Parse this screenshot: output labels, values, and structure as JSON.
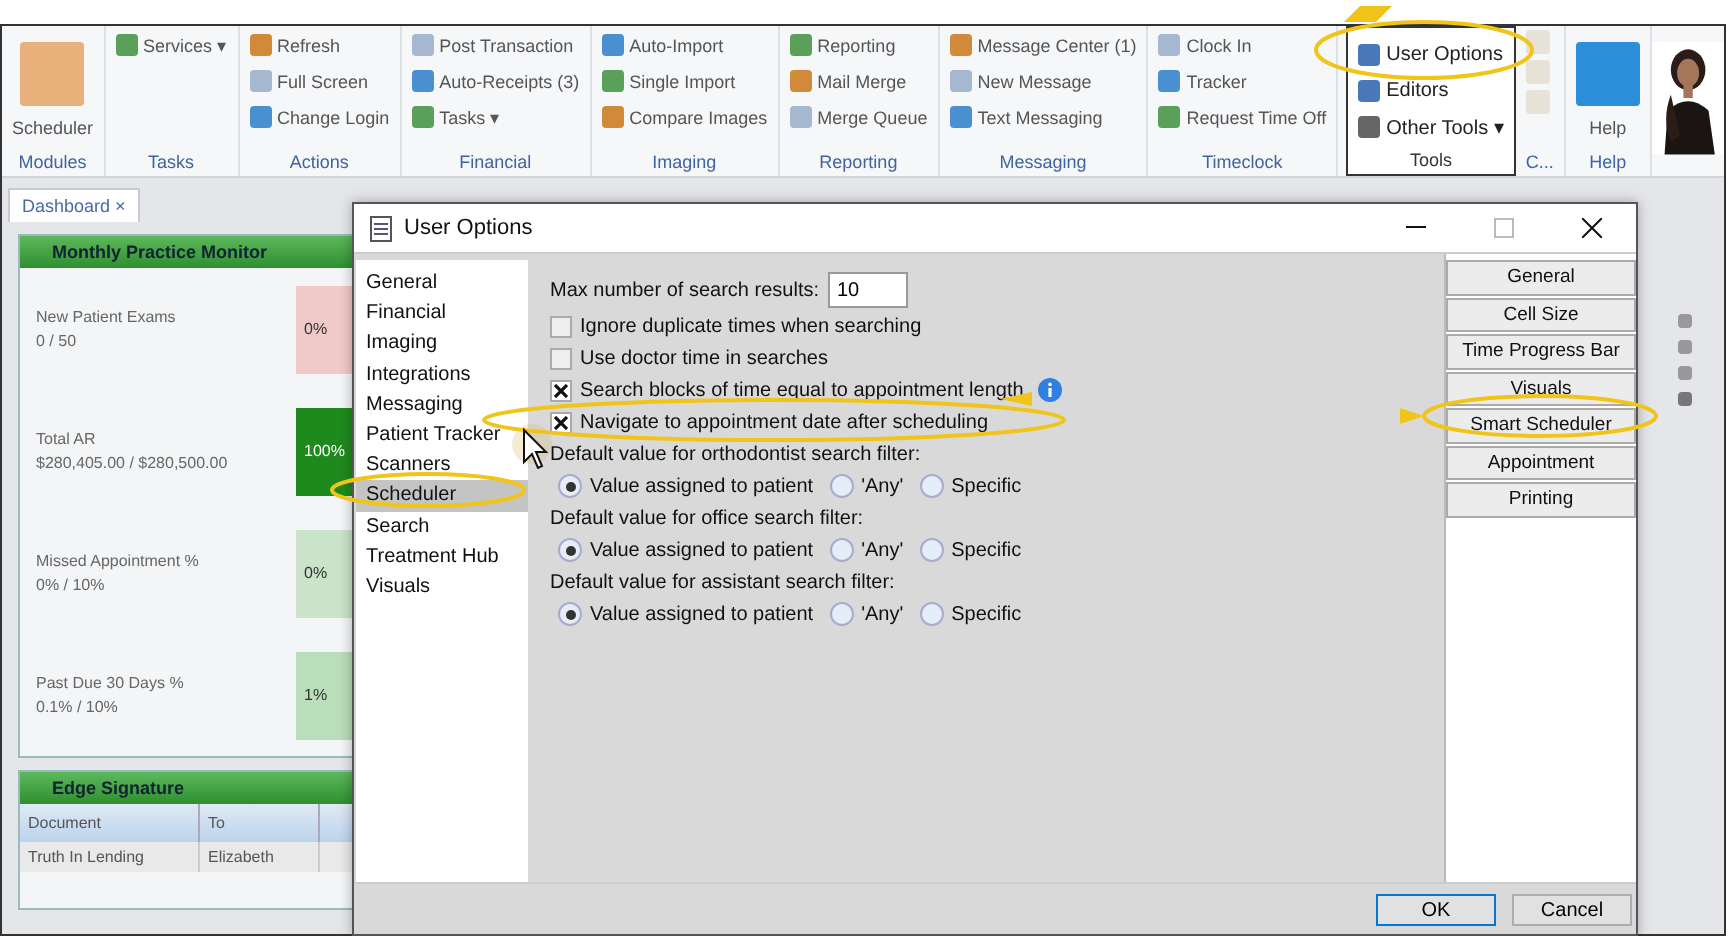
{
  "ribbon": {
    "groups": [
      {
        "label": "Modules",
        "highlighted": false,
        "large": true,
        "items": [
          "Scheduler"
        ]
      },
      {
        "label": "Tasks",
        "highlighted": false,
        "large": false,
        "items": [
          "Services ▾"
        ]
      },
      {
        "label": "Actions",
        "highlighted": false,
        "large": false,
        "items": [
          "Refresh",
          "Full Screen",
          "Change Login"
        ]
      },
      {
        "label": "Financial",
        "highlighted": false,
        "large": false,
        "items": [
          "Post Transaction",
          "Auto-Receipts (3)",
          "Tasks ▾"
        ]
      },
      {
        "label": "Imaging",
        "highlighted": false,
        "large": false,
        "items": [
          "Auto-Import",
          "Single Import",
          "Compare Images"
        ]
      },
      {
        "label": "Reporting",
        "highlighted": false,
        "large": false,
        "items": [
          "Reporting",
          "Mail Merge",
          "Merge Queue"
        ]
      },
      {
        "label": "Messaging",
        "highlighted": false,
        "large": false,
        "items": [
          "Message Center (1)",
          "New Message",
          "Text Messaging"
        ]
      },
      {
        "label": "Timeclock",
        "highlighted": false,
        "large": false,
        "items": [
          "Clock In",
          "Tracker",
          "Request Time Off"
        ]
      },
      {
        "label": "Tools",
        "highlighted": true,
        "large": false,
        "items": [
          "User Options",
          "Editors",
          "Other Tools ▾"
        ]
      },
      {
        "label": "C...",
        "highlighted": false,
        "large": false
      },
      {
        "label": "Help",
        "highlighted": false,
        "large": true,
        "items": [
          "Help"
        ]
      }
    ]
  },
  "document_tab": {
    "label": "Dashboard",
    "close": "×"
  },
  "monitor": {
    "title": "Monthly Practice Monitor",
    "rows": [
      {
        "name": "New Patient Exams",
        "reading": "0 / 50",
        "percent": "0%",
        "color": "#f2c9c9"
      },
      {
        "name": "Total AR",
        "reading": "$280,405.00 / $280,500.00",
        "percent": "100%",
        "color": "#1e8a1e"
      },
      {
        "name": "Missed Appointment %",
        "reading": "0% / 10%",
        "percent": "0%",
        "color": "#c9e4c9"
      },
      {
        "name": "Past Due 30 Days %",
        "reading": "0.1% / 10%",
        "percent": "1%",
        "color": "#b9deb9"
      }
    ]
  },
  "signature": {
    "title": "Edge Signature",
    "columns": [
      "Document",
      "To"
    ],
    "rows": [
      [
        "Truth In Lending",
        "Elizabeth"
      ]
    ]
  },
  "dialog": {
    "title": "User Options",
    "nav": [
      {
        "label": "General",
        "selected": false
      },
      {
        "label": "Financial",
        "selected": false
      },
      {
        "label": "Imaging",
        "selected": false
      },
      {
        "label": "Integrations",
        "selected": false
      },
      {
        "label": "Messaging",
        "selected": false
      },
      {
        "label": "Patient Tracker",
        "selected": false
      },
      {
        "label": "Scanners",
        "selected": false
      },
      {
        "label": "Scheduler",
        "selected": true
      },
      {
        "label": "Search",
        "selected": false
      },
      {
        "label": "Treatment Hub",
        "selected": false
      },
      {
        "label": "Visuals",
        "selected": false
      }
    ],
    "max_results": {
      "label": "Max number of search results:",
      "value": "10"
    },
    "checkboxes": [
      {
        "label": "Ignore duplicate times when searching",
        "checked": false,
        "info": false
      },
      {
        "label": "Use doctor time in searches",
        "checked": false,
        "info": false
      },
      {
        "label": "Search blocks of time equal to appointment length",
        "checked": true,
        "info": true
      },
      {
        "label": "Navigate to appointment date after scheduling",
        "checked": true,
        "info": false
      }
    ],
    "filters": [
      {
        "label": "Default value for orthodontist search filter:",
        "options": [
          {
            "label": "Value assigned to patient",
            "selected": true
          },
          {
            "label": "'Any'",
            "selected": false
          },
          {
            "label": "Specific",
            "selected": false
          }
        ]
      },
      {
        "label": "Default value for office search filter:",
        "options": [
          {
            "label": "Value assigned to patient",
            "selected": true
          },
          {
            "label": "'Any'",
            "selected": false
          },
          {
            "label": "Specific",
            "selected": false
          }
        ]
      },
      {
        "label": "Default value for assistant search filter:",
        "options": [
          {
            "label": "Value assigned to patient",
            "selected": true
          },
          {
            "label": "'Any'",
            "selected": false
          },
          {
            "label": "Specific",
            "selected": false
          }
        ]
      }
    ],
    "sections": [
      "General",
      "Cell Size",
      "Time Progress Bar",
      "Visuals",
      "Smart Scheduler",
      "Appointment",
      "Printing"
    ],
    "buttons": [
      {
        "label": "OK",
        "default": true
      },
      {
        "label": "Cancel",
        "default": false
      }
    ]
  }
}
